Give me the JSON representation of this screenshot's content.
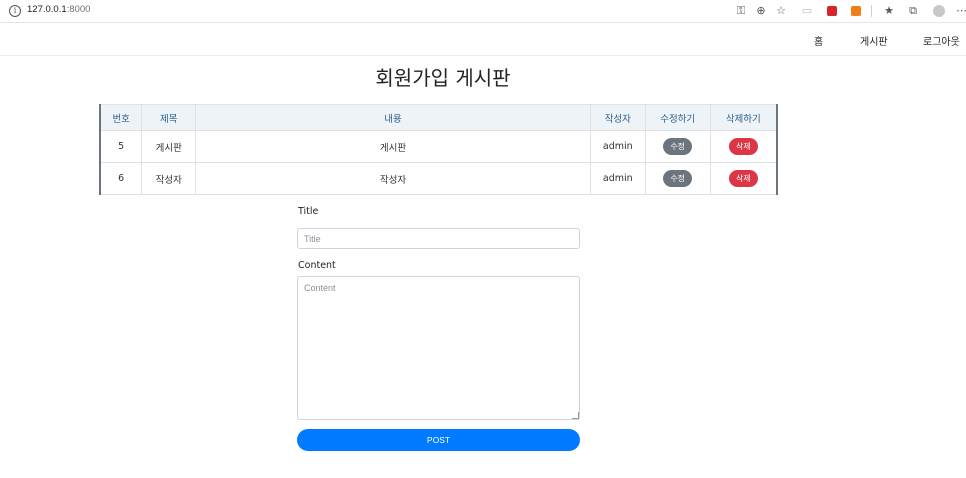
{
  "browser": {
    "url_host": "127.0.0.1",
    "url_port": ":8000",
    "info_icon": "info-icon",
    "icons": [
      "key-icon",
      "zoom-icon",
      "favorite-star-icon",
      "extension-icon",
      "record-icon",
      "rss-icon",
      "favorites-icon",
      "collections-icon",
      "profile-icon",
      "more-icon"
    ]
  },
  "nav": {
    "home": "홈",
    "board": "게시판",
    "logout": "로그아웃"
  },
  "page_title": "회원가입 게시판",
  "table": {
    "headers": [
      "번호",
      "제목",
      "내용",
      "작성자",
      "수정하기",
      "삭제하기"
    ],
    "rows": [
      {
        "no": "5",
        "title": "게시판",
        "content": "게시판",
        "author": "admin",
        "edit": "수정",
        "delete": "삭제"
      },
      {
        "no": "6",
        "title": "작성자",
        "content": "작성자",
        "author": "admin",
        "edit": "수정",
        "delete": "삭제"
      }
    ]
  },
  "form": {
    "title_label": "Title",
    "title_placeholder": "Title",
    "content_label": "Content",
    "content_placeholder": "Content",
    "submit_label": "POST"
  },
  "colors": {
    "primary": "#007bff",
    "edit_badge": "#6c757d",
    "delete_badge": "#dc3545",
    "header_text": "#2b5f8c",
    "header_bg": "#eef3f8"
  }
}
